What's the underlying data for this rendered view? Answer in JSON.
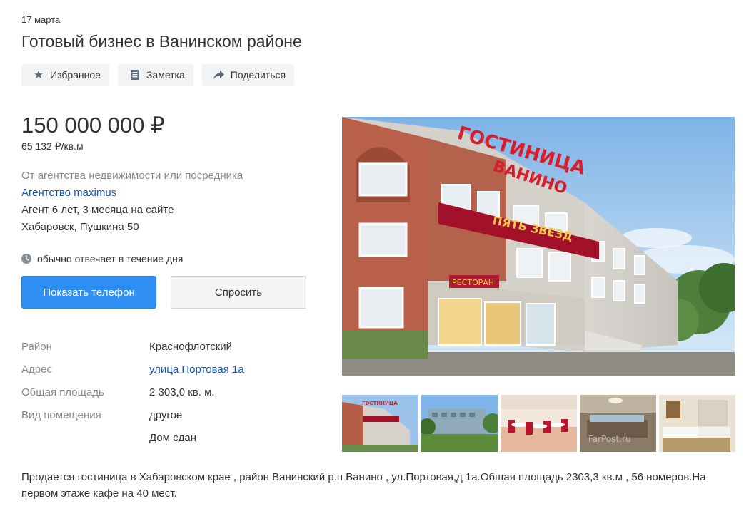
{
  "listing": {
    "date": "17 марта",
    "title": "Готовый бизнес в Ванинском районе"
  },
  "actions": [
    {
      "label": "Избранное",
      "icon": "star-icon"
    },
    {
      "label": "Заметка",
      "icon": "note-icon"
    },
    {
      "label": "Поделиться",
      "icon": "share-icon"
    }
  ],
  "price": {
    "total": "150 000 000 ₽",
    "per_m2": "65 132 ₽/кв.м"
  },
  "seller": {
    "type": "От агентства недвижимости или посредника",
    "agency": "Агентство maximus",
    "experience": "Агент 6 лет, 3 месяца на сайте",
    "address": "Хабаровск, Пушкина 50",
    "response": "обычно отвечает в течение дня"
  },
  "buttons": {
    "phone": "Показать телефон",
    "ask": "Спросить"
  },
  "params": [
    {
      "label": "Район",
      "value": "Краснофлотский"
    },
    {
      "label": "Адрес",
      "value": "улица Портовая 1а"
    },
    {
      "label": "Общая площадь",
      "value": "2 303,0 кв. м."
    },
    {
      "label": "Вид помещения",
      "value": "другое"
    },
    {
      "label": "",
      "value": "Дом сдан"
    }
  ],
  "photo": {
    "sign_main": "ГОСТИНИЦА",
    "sign_sub": "ВАНИНО",
    "sign_banner": "ПЯТЬ ЗВЕЗД",
    "sign_restaurant": "РЕСТОРАН",
    "watermark": "FarPost.ru"
  },
  "description": "Продается гостиница в Хабаровском крае , район Ванинский р.п Ванино , ул.Портовая,д 1а.Общая площадь 2303,3 кв.м , 56 номеров.На первом этаже кафе на 40 мест.",
  "colors": {
    "link": "#1455b8",
    "primary_button": "#2e8ef2",
    "muted_text": "#8a8a8a"
  }
}
